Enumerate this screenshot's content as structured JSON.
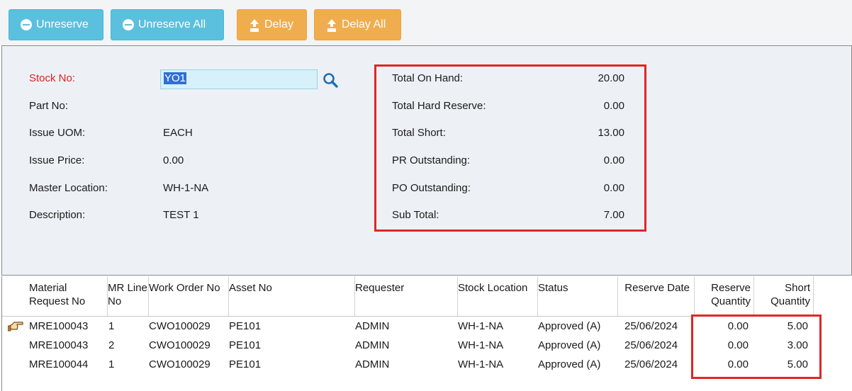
{
  "toolbar": {
    "unreserve": "Unreserve",
    "unreserve_all": "Unreserve All",
    "delay": "Delay",
    "delay_all": "Delay All",
    "colors": {
      "blue": "#5bc0de",
      "orange": "#f0ad4e"
    }
  },
  "form": {
    "stock_no_label": "Stock No:",
    "stock_no_value": "YO1",
    "part_no_label": "Part No:",
    "part_no_value": "",
    "issue_uom_label": "Issue UOM:",
    "issue_uom_value": "EACH",
    "issue_price_label": "Issue Price:",
    "issue_price_value": "0.00",
    "master_location_label": "Master Location:",
    "master_location_value": "WH-1-NA",
    "description_label": "Description:",
    "description_value": "TEST 1"
  },
  "totals": {
    "on_hand_label": "Total On Hand:",
    "on_hand": "20.00",
    "hard_reserve_label": "Total Hard Reserve:",
    "hard_reserve": "0.00",
    "short_label": "Total Short:",
    "short": "13.00",
    "pr_label": "PR Outstanding:",
    "pr": "0.00",
    "po_label": "PO Outstanding:",
    "po": "0.00",
    "sub_total_label": "Sub Total:",
    "sub_total": "7.00"
  },
  "grid": {
    "headers": {
      "mr_no_1": "Material",
      "mr_no_2": "Request No",
      "mr_line_1": "MR Line",
      "mr_line_2": "No",
      "wo_no": "Work Order No",
      "asset_no": "Asset No",
      "requester": "Requester",
      "stock_location": "Stock Location",
      "status": "Status",
      "reserve_date": "Reserve Date",
      "reserve_qty_1": "Reserve",
      "reserve_qty_2": "Quantity",
      "short_qty_1": "Short",
      "short_qty_2": "Quantity"
    },
    "rows": [
      {
        "mr_no": "MRE100043",
        "line": "1",
        "wo": "CWO100029",
        "asset": "PE101",
        "requester": "ADMIN",
        "location": "WH-1-NA",
        "status": "Approved (A)",
        "date": "25/06/2024",
        "reserve": "0.00",
        "short": "5.00"
      },
      {
        "mr_no": "MRE100043",
        "line": "2",
        "wo": "CWO100029",
        "asset": "PE101",
        "requester": "ADMIN",
        "location": "WH-1-NA",
        "status": "Approved (A)",
        "date": "25/06/2024",
        "reserve": "0.00",
        "short": "3.00"
      },
      {
        "mr_no": "MRE100044",
        "line": "1",
        "wo": "CWO100029",
        "asset": "PE101",
        "requester": "ADMIN",
        "location": "WH-1-NA",
        "status": "Approved (A)",
        "date": "25/06/2024",
        "reserve": "0.00",
        "short": "5.00"
      }
    ],
    "current_row_icon": "pointing-hand-icon"
  }
}
